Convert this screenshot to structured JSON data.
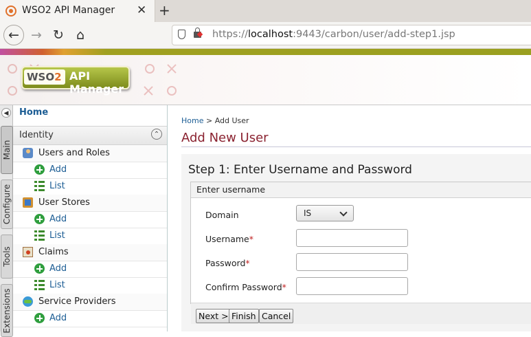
{
  "browser": {
    "tab_title": "WSO2 API Manager",
    "tab_close": "✕",
    "new_tab": "+",
    "url_prefix": "https://",
    "url_host": "localhost",
    "url_rest": ":9443/carbon/user/add-step1.jsp"
  },
  "header": {
    "logo_wso": "WSO",
    "logo_num": "2",
    "logo_product": "API Manager"
  },
  "vertical_tabs": {
    "main": "Main",
    "configure": "Configure",
    "tools": "Tools",
    "extensions": "Extensions"
  },
  "menu": {
    "home": "Home",
    "section": "Identity",
    "items": [
      {
        "label": "Users and Roles",
        "icon": "users-icon"
      },
      {
        "label": "Add",
        "icon": "add-icon"
      },
      {
        "label": "List",
        "icon": "list-icon"
      },
      {
        "label": "User Stores",
        "icon": "user-store-icon"
      },
      {
        "label": "Add",
        "icon": "add-icon"
      },
      {
        "label": "List",
        "icon": "list-icon"
      },
      {
        "label": "Claims",
        "icon": "claims-icon"
      },
      {
        "label": "Add",
        "icon": "add-icon"
      },
      {
        "label": "List",
        "icon": "list-icon"
      },
      {
        "label": "Service Providers",
        "icon": "service-provider-icon"
      },
      {
        "label": "Add",
        "icon": "add-icon"
      }
    ]
  },
  "content": {
    "breadcrumb_home": "Home",
    "breadcrumb_sep": " > ",
    "breadcrumb_current": "Add User",
    "page_title": "Add New User",
    "step_title": "Step 1: Enter Username and Password",
    "form_header": "Enter username",
    "domain_label": "Domain",
    "domain_value": "IS",
    "username_label": "Username",
    "password_label": "Password",
    "confirm_label": "Confirm Password",
    "required_mark": "*",
    "buttons": {
      "next": "Next >",
      "finish": "Finish",
      "cancel": "Cancel"
    }
  },
  "colors": {
    "accent_link": "#1c5d94",
    "page_title": "#8a2230",
    "logo_green": "#9aa020"
  }
}
